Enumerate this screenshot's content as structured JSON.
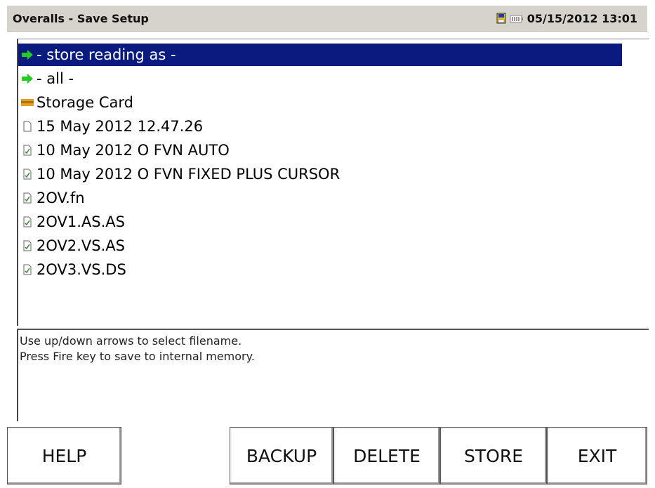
{
  "window": {
    "title": "Overalls - Save Setup",
    "datetime": "05/15/2012 13:01",
    "status_icons": [
      "storage-card-icon",
      "battery-icon"
    ]
  },
  "list": {
    "selected_index": 0,
    "items": [
      {
        "label": "- store reading as -",
        "icon": "green-arrow-icon"
      },
      {
        "label": "- all -",
        "icon": "green-arrow-icon"
      },
      {
        "label": "Storage Card",
        "icon": "folder-icon"
      },
      {
        "label": "15 May 2012 12.47.26",
        "icon": "file-icon"
      },
      {
        "label": "10 May 2012 O FVN AUTO",
        "icon": "file-checked-icon"
      },
      {
        "label": "10 May 2012 O FVN FIXED PLUS CURSOR",
        "icon": "file-checked-icon"
      },
      {
        "label": "2OV.fn",
        "icon": "file-checked-icon"
      },
      {
        "label": "2OV1.AS.AS",
        "icon": "file-checked-icon"
      },
      {
        "label": "2OV2.VS.AS",
        "icon": "file-checked-icon"
      },
      {
        "label": "2OV3.VS.DS",
        "icon": "file-checked-icon"
      }
    ]
  },
  "hints": [
    "Use up/down arrows to select filename.",
    "Press Fire key to save to internal memory."
  ],
  "buttons": {
    "help": "HELP",
    "backup": "BACKUP",
    "delete": "DELETE",
    "store": "STORE",
    "exit": "EXIT"
  },
  "colors": {
    "selection": "#0a1a7f",
    "titlebar": "#d6d3cc",
    "arrow": "#22cc22",
    "folder": "#e0a020"
  }
}
